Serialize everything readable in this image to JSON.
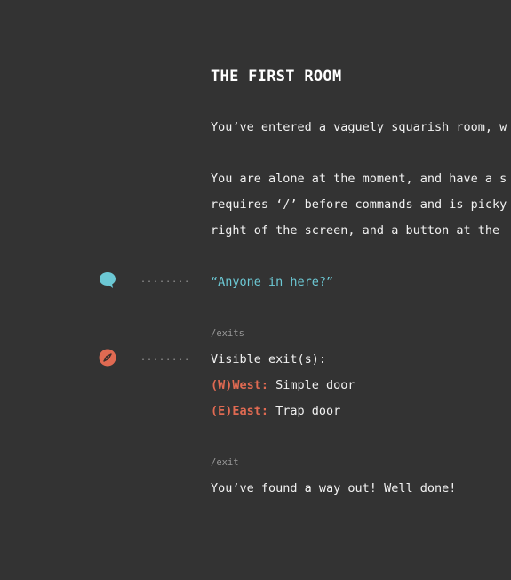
{
  "room": {
    "title": "THE FIRST ROOM",
    "description_1": "You’ve entered a vaguely squarish room, w",
    "description_2": "You are alone at the moment, and have a s",
    "description_3": "requires ‘/’ before commands and is picky",
    "description_4": "right of the screen, and a button at the "
  },
  "speech": {
    "icon": "speech-bubble-icon",
    "text": "“Anyone in here?”",
    "color": "#6cc8d4"
  },
  "exits": {
    "icon": "compass-icon",
    "color": "#e06a52",
    "command": "/exits",
    "heading": "Visible exit(s):",
    "items": [
      {
        "key": "(W)West:",
        "value": " Simple door"
      },
      {
        "key": "(E)East:",
        "value": " Trap door"
      }
    ]
  },
  "exit": {
    "command": "/exit",
    "message": "You’ve found a way out! Well done!"
  },
  "dots": "........"
}
